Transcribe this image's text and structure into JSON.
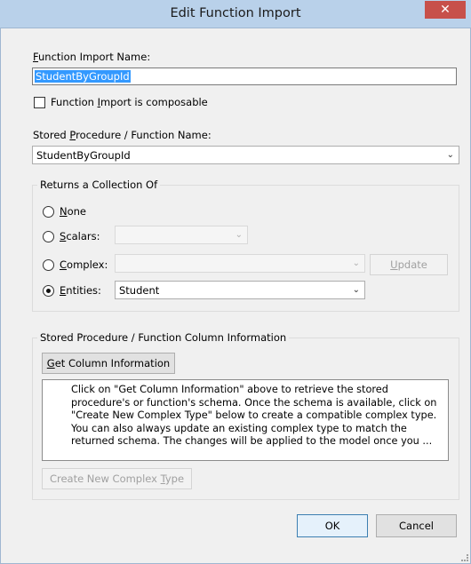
{
  "window": {
    "title": "Edit Function Import",
    "close_label": "✕"
  },
  "function_import_name": {
    "label_pre": "",
    "label_mnemonic": "F",
    "label_post": "unction Import Name:",
    "value": "StudentByGroupId"
  },
  "composable": {
    "label_pre": "Function ",
    "label_mnemonic": "I",
    "label_post": "mport is composable",
    "checked": false
  },
  "stored_procedure": {
    "label_pre": "Stored ",
    "label_mnemonic": "P",
    "label_post": "rocedure / Function Name:",
    "value": "StudentByGroupId"
  },
  "returns": {
    "group_title": "Returns a Collection Of",
    "options": [
      {
        "pre": "",
        "mnemonic": "N",
        "post": "one",
        "selected": false
      },
      {
        "pre": "",
        "mnemonic": "S",
        "post": "calars:",
        "selected": false
      },
      {
        "pre": "",
        "mnemonic": "C",
        "post": "omplex:",
        "selected": false
      },
      {
        "pre": "",
        "mnemonic": "E",
        "post": "ntities:",
        "selected": true
      }
    ],
    "scalars_value": "",
    "complex_value": "",
    "entities_value": "Student",
    "update_label_pre": "",
    "update_label_mnemonic": "U",
    "update_label_post": "pdate"
  },
  "column_info": {
    "group_title": "Stored Procedure / Function Column Information",
    "get_button_pre": "",
    "get_button_mnemonic": "G",
    "get_button_post": "et Column Information",
    "message": "Click on \"Get Column Information\" above to retrieve the stored procedure's or function's schema. Once the schema is available, click on \"Create New Complex Type\" below to create a compatible complex type. You can also always update an existing complex type to match the returned schema. The changes will be applied to the model once you ...",
    "create_button_pre": "Create New Complex ",
    "create_button_mnemonic": "T",
    "create_button_post": "ype"
  },
  "footer": {
    "ok_label": "OK",
    "cancel_label": "Cancel"
  }
}
